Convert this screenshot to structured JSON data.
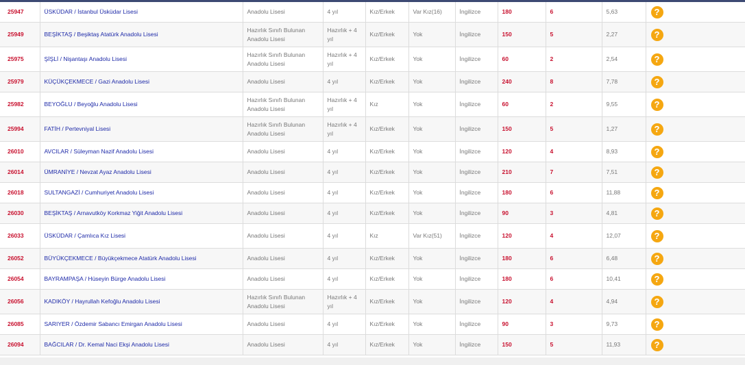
{
  "rows": [
    {
      "code": "25947",
      "name": "ÜSKÜDAR / İstanbul Üsküdar Lisesi",
      "type": "Anadolu Lisesi",
      "duration": "4 yıl",
      "gender": "Kız/Erkek",
      "boarding": "Var Kız(16)",
      "language": "İngilizce",
      "quota": "180",
      "score": "6",
      "percentile": "5,63",
      "tall": false
    },
    {
      "code": "25949",
      "name": "BEŞİKTAŞ / Beşiktaş Atatürk Anadolu Lisesi",
      "type": "Hazırlık Sınıfı Bulunan Anadolu Lisesi",
      "duration": "Hazırlık + 4 yıl",
      "gender": "Kız/Erkek",
      "boarding": "Yok",
      "language": "İngilizce",
      "quota": "150",
      "score": "5",
      "percentile": "2,27",
      "tall": true
    },
    {
      "code": "25975",
      "name": "ŞİŞLİ / Nişantaşı Anadolu Lisesi",
      "type": "Hazırlık Sınıfı Bulunan Anadolu Lisesi",
      "duration": "Hazırlık + 4 yıl",
      "gender": "Kız/Erkek",
      "boarding": "Yok",
      "language": "İngilizce",
      "quota": "60",
      "score": "2",
      "percentile": "2,54",
      "tall": true
    },
    {
      "code": "25979",
      "name": "KÜÇÜKÇEKMECE / Gazi Anadolu Lisesi",
      "type": "Anadolu Lisesi",
      "duration": "4 yıl",
      "gender": "Kız/Erkek",
      "boarding": "Yok",
      "language": "İngilizce",
      "quota": "240",
      "score": "8",
      "percentile": "7,78",
      "tall": false
    },
    {
      "code": "25982",
      "name": "BEYOĞLU / Beyoğlu Anadolu Lisesi",
      "type": "Hazırlık Sınıfı Bulunan Anadolu Lisesi",
      "duration": "Hazırlık + 4 yıl",
      "gender": "Kız",
      "boarding": "Yok",
      "language": "İngilizce",
      "quota": "60",
      "score": "2",
      "percentile": "9,55",
      "tall": true
    },
    {
      "code": "25994",
      "name": "FATİH / Pertevniyal Lisesi",
      "type": "Hazırlık Sınıfı Bulunan Anadolu Lisesi",
      "duration": "Hazırlık + 4 yıl",
      "gender": "Kız/Erkek",
      "boarding": "Yok",
      "language": "İngilizce",
      "quota": "150",
      "score": "5",
      "percentile": "1,27",
      "tall": true
    },
    {
      "code": "26010",
      "name": "AVCILAR / Süleyman Nazif Anadolu Lisesi",
      "type": "Anadolu Lisesi",
      "duration": "4 yıl",
      "gender": "Kız/Erkek",
      "boarding": "Yok",
      "language": "İngilizce",
      "quota": "120",
      "score": "4",
      "percentile": "8,93",
      "tall": false
    },
    {
      "code": "26014",
      "name": "ÜMRANİYE / Nevzat Ayaz Anadolu Lisesi",
      "type": "Anadolu Lisesi",
      "duration": "4 yıl",
      "gender": "Kız/Erkek",
      "boarding": "Yok",
      "language": "İngilizce",
      "quota": "210",
      "score": "7",
      "percentile": "7,51",
      "tall": false
    },
    {
      "code": "26018",
      "name": "SULTANGAZİ / Cumhuriyet Anadolu Lisesi",
      "type": "Anadolu Lisesi",
      "duration": "4 yıl",
      "gender": "Kız/Erkek",
      "boarding": "Yok",
      "language": "İngilizce",
      "quota": "180",
      "score": "6",
      "percentile": "11,88",
      "tall": false
    },
    {
      "code": "26030",
      "name": "BEŞİKTAŞ / Arnavutköy Korkmaz Yiğit Anadolu Lisesi",
      "type": "Anadolu Lisesi",
      "duration": "4 yıl",
      "gender": "Kız/Erkek",
      "boarding": "Yok",
      "language": "İngilizce",
      "quota": "90",
      "score": "3",
      "percentile": "4,81",
      "tall": false
    },
    {
      "code": "26033",
      "name": "ÜSKÜDAR / Çamlıca Kız Lisesi",
      "type": "Anadolu Lisesi",
      "duration": "4 yıl",
      "gender": "Kız",
      "boarding": "Var Kız(51)",
      "language": "İngilizce",
      "quota": "120",
      "score": "4",
      "percentile": "12,07",
      "tall": true
    },
    {
      "code": "26052",
      "name": "BÜYÜKÇEKMECE / Büyükçekmece Atatürk Anadolu Lisesi",
      "type": "Anadolu Lisesi",
      "duration": "4 yıl",
      "gender": "Kız/Erkek",
      "boarding": "Yok",
      "language": "İngilizce",
      "quota": "180",
      "score": "6",
      "percentile": "6,48",
      "tall": false
    },
    {
      "code": "26054",
      "name": "BAYRAMPAŞA / Hüseyin Bürge Anadolu Lisesi",
      "type": "Anadolu Lisesi",
      "duration": "4 yıl",
      "gender": "Kız/Erkek",
      "boarding": "Yok",
      "language": "İngilizce",
      "quota": "180",
      "score": "6",
      "percentile": "10,41",
      "tall": false
    },
    {
      "code": "26056",
      "name": "KADIKÖY / Hayrullah Kefoğlu Anadolu Lisesi",
      "type": "Hazırlık Sınıfı Bulunan Anadolu Lisesi",
      "duration": "Hazırlık + 4 yıl",
      "gender": "Kız/Erkek",
      "boarding": "Yok",
      "language": "İngilizce",
      "quota": "120",
      "score": "4",
      "percentile": "4,94",
      "tall": true
    },
    {
      "code": "26085",
      "name": "SARIYER / Özdemir Sabancı Emirgan Anadolu Lisesi",
      "type": "Anadolu Lisesi",
      "duration": "4 yıl",
      "gender": "Kız/Erkek",
      "boarding": "Yok",
      "language": "İngilizce",
      "quota": "90",
      "score": "3",
      "percentile": "9,73",
      "tall": false
    },
    {
      "code": "26094",
      "name": "BAĞCILAR / Dr. Kemal Naci Ekşi Anadolu Lisesi",
      "type": "Anadolu Lisesi",
      "duration": "4 yıl",
      "gender": "Kız/Erkek",
      "boarding": "Yok",
      "language": "İngilizce",
      "quota": "150",
      "score": "5",
      "percentile": "11,93",
      "tall": false
    }
  ],
  "help_icon": "question-circle-icon",
  "colors": {
    "code": "#c8102e",
    "link": "#1e2aa8",
    "help": "#f5a711",
    "topbar": "#3d4a73"
  }
}
